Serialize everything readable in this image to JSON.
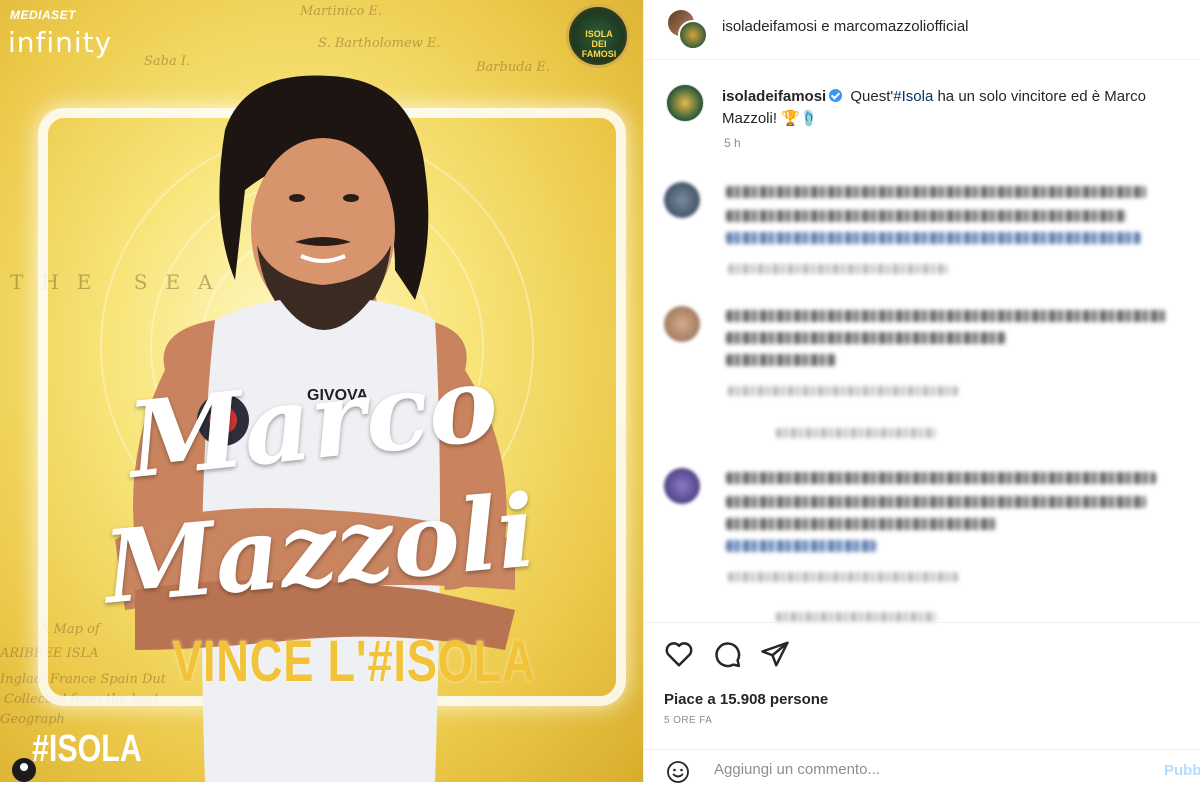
{
  "media": {
    "brand_top": "MEDIASET",
    "brand_bottom": "infinity",
    "show_logo": "ISOLA DEI FAMOSI",
    "name_line1": "Marco",
    "name_line2": "Mazzoli",
    "headline": "VINCE L'#ISOLA",
    "hashtag": "#ISOLA",
    "map_labels": [
      "Martinico E.",
      "S. Bartholomew E.",
      "Barbuda E.",
      "Saba I.",
      "THE SEA",
      "A Map of",
      "ARIBBEE ISLA",
      "Inglaoi France Spain Dut",
      "Collected from the best",
      "Geograph"
    ],
    "colors": {
      "background": "#ecc94a",
      "headline": "#f2c238"
    }
  },
  "post": {
    "header": {
      "title": "isoladeifamosi e marcomazzoliofficial"
    },
    "caption": {
      "username": "isoladeifamosi",
      "text_before": " Quest'",
      "hashtag": "#Isola",
      "text_after": " ha un solo vincitore ed è Marco Mazzoli! 🏆🩴",
      "time": "5 h"
    },
    "actions": {
      "like_icon": "heart-icon",
      "comment_icon": "comment-icon",
      "share_icon": "share-icon"
    },
    "likes_text": "Piace a 15.908 persone",
    "post_time": "5 ORE FA",
    "add_comment": {
      "placeholder": "Aggiungi un commento...",
      "publish_label": "Pubblica"
    }
  }
}
